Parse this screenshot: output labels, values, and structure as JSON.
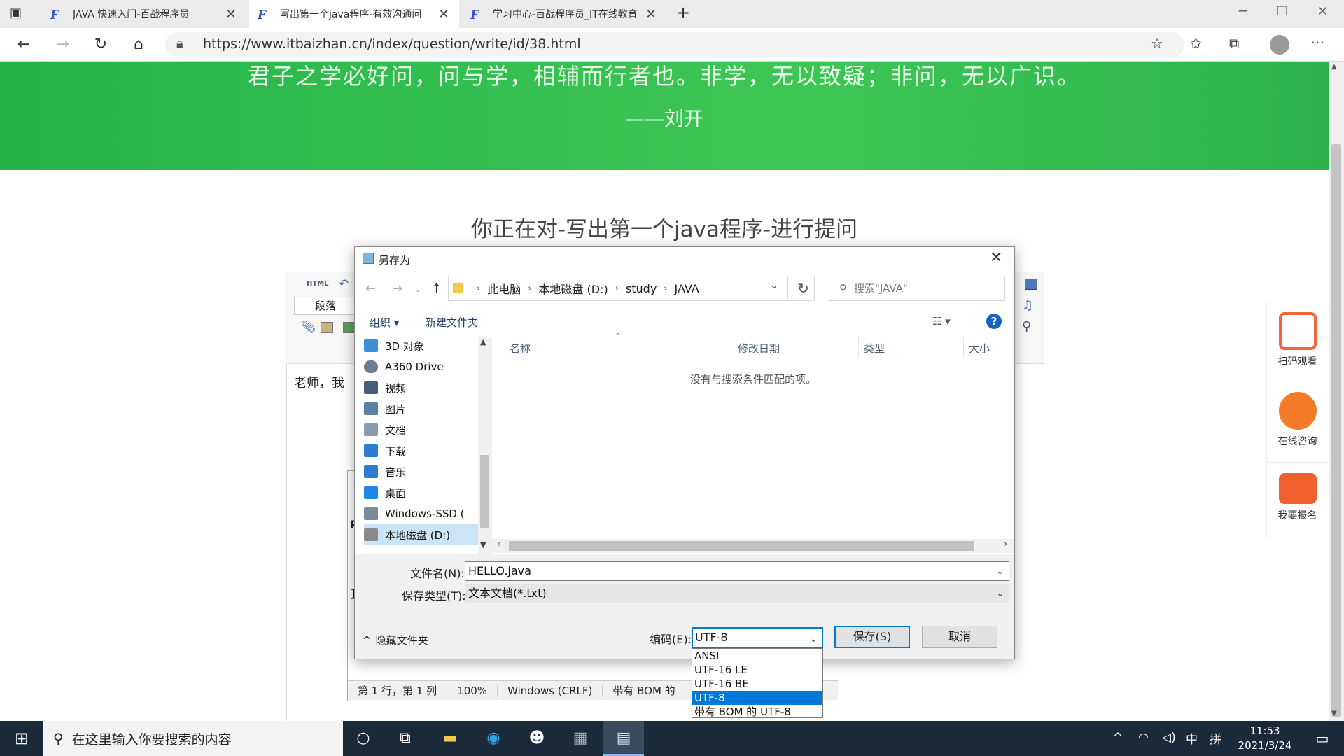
{
  "browser": {
    "tabs": [
      {
        "label": "JAVA 快速入门-百战程序员",
        "icon": "tab-icon"
      },
      {
        "label": "写出第一个java程序-有效沟通问",
        "icon": "tab-icon"
      },
      {
        "label": "学习中心-百战程序员_IT在线教育",
        "icon": "tab-icon"
      }
    ],
    "new_tab": "+",
    "url": "https://www.itbaizhan.cn/index/question/write/id/38.html"
  },
  "page": {
    "quote": "君子之学必好问，问与学，相辅而行者也。非学，无以致疑；非问，无以广识。",
    "quote_author": "——刘开",
    "heading": "你正在对-写出第一个java程序-进行提问",
    "editor_toolbar": {
      "html_label": "HTML",
      "paragraph": "段落"
    },
    "editor_text": "老师，我",
    "side": [
      {
        "label": "扫码观看",
        "icon": "scan-icon",
        "color": "#f4643c"
      },
      {
        "label": "在线咨询",
        "icon": "headset-icon",
        "color": "#f47b2a"
      },
      {
        "label": "我要报名",
        "icon": "wallet-icon",
        "color": "#f0602e"
      }
    ]
  },
  "notepad": {
    "status": [
      "第 1 行，第 1 列",
      "100%",
      "Windows (CRLF)",
      "带有 BOM 的"
    ]
  },
  "dialog": {
    "title": "另存为",
    "breadcrumb": [
      "此电脑",
      "本地磁盘 (D:)",
      "study",
      "JAVA"
    ],
    "search_placeholder": "搜索\"JAVA\"",
    "toolbar": {
      "organize": "组织 ▾",
      "new_folder": "新建文件夹",
      "help": "?"
    },
    "nav_items": [
      {
        "label": "3D 对象",
        "color": "#3d8ed8"
      },
      {
        "label": "A360 Drive",
        "color": "#6b7c8e"
      },
      {
        "label": "视频",
        "color": "#4a5d78"
      },
      {
        "label": "图片",
        "color": "#5a7fa8"
      },
      {
        "label": "文档",
        "color": "#8a9bb0"
      },
      {
        "label": "下载",
        "color": "#2f7bd0"
      },
      {
        "label": "音乐",
        "color": "#2f7bd0"
      },
      {
        "label": "桌面",
        "color": "#1e88e5"
      },
      {
        "label": "Windows-SSD (",
        "color": "#7a8a99"
      },
      {
        "label": "本地磁盘 (D:)",
        "color": "#8a8a8a"
      }
    ],
    "columns": [
      "名称",
      "修改日期",
      "类型",
      "大小"
    ],
    "empty_message": "没有与搜索条件匹配的项。",
    "filename_label": "文件名(N):",
    "filename_value": "HELLO.java",
    "filetype_label": "保存类型(T):",
    "filetype_value": "文本文档(*.txt)",
    "hide_folders": "隐藏文件夹",
    "encoding_label": "编码(E):",
    "encoding_value": "UTF-8",
    "encoding_options": [
      "ANSI",
      "UTF-16 LE",
      "UTF-16 BE",
      "UTF-8",
      "带有 BOM 的 UTF-8"
    ],
    "encoding_selected_index": 3,
    "save_label": "保存(S)",
    "cancel_label": "取消"
  },
  "taskbar": {
    "search_placeholder": "在这里输入你要搜索的内容",
    "tray_ime": "中",
    "tray_layout": "拼",
    "time": "11:53",
    "date": "2021/3/24"
  }
}
